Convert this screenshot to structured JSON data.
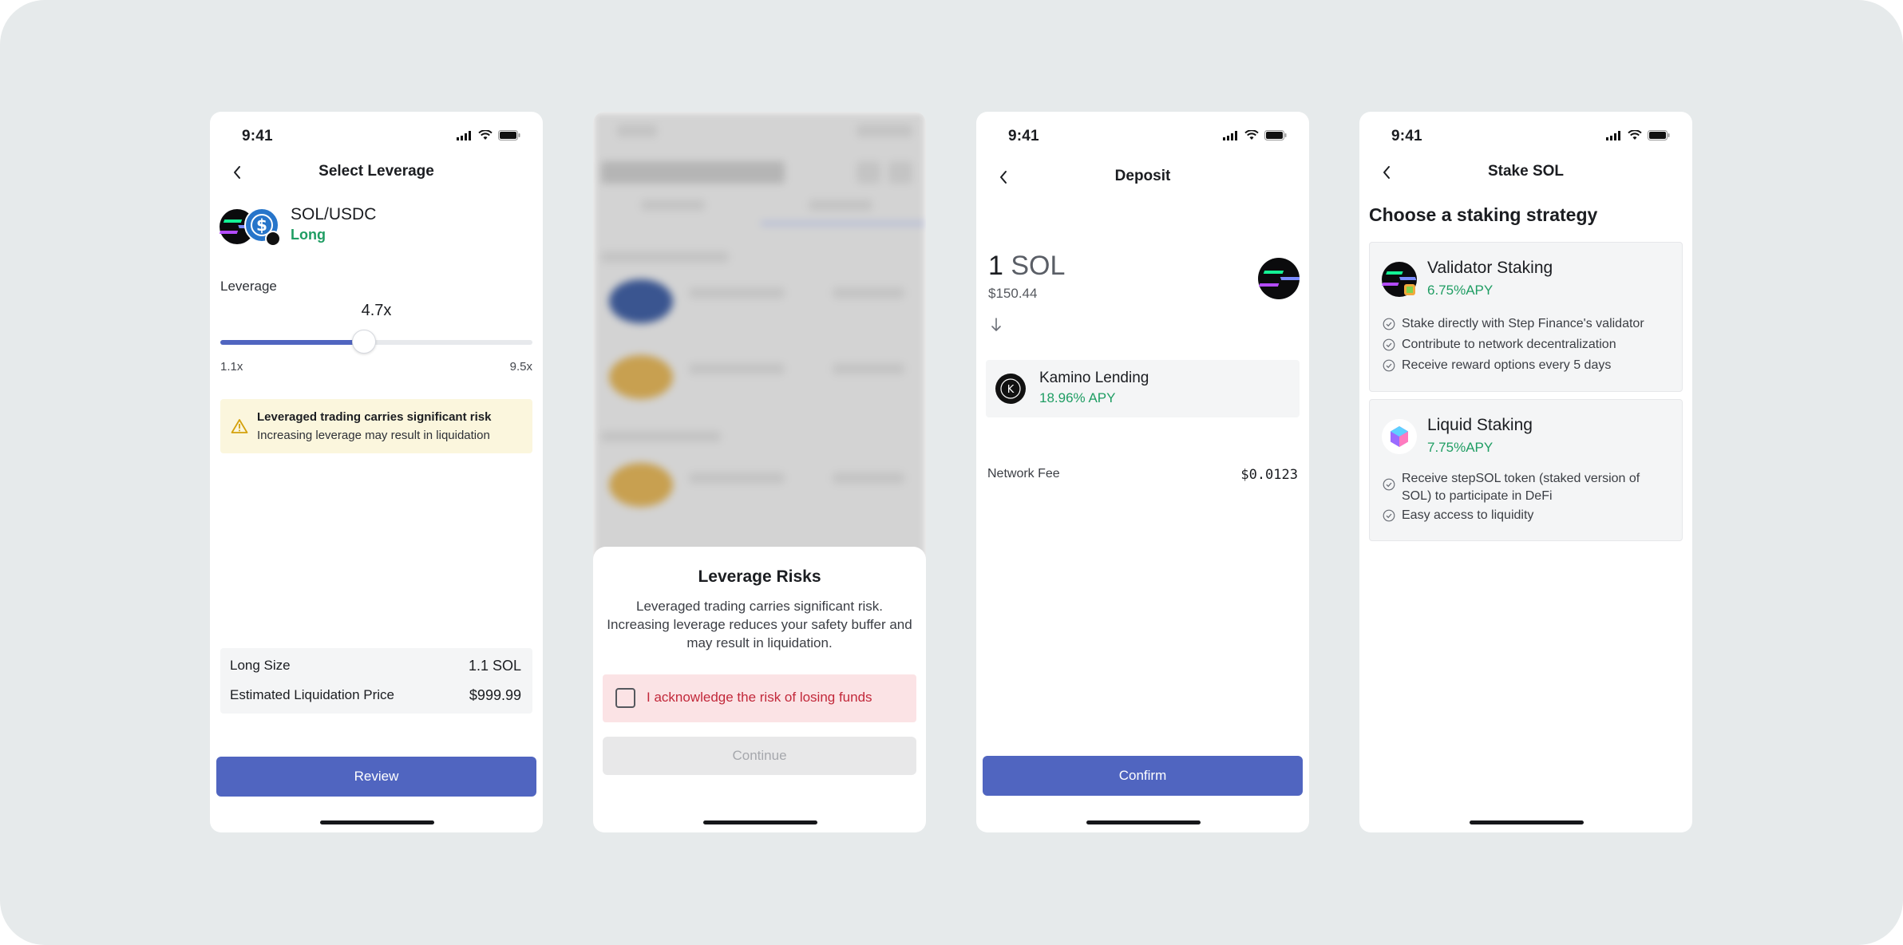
{
  "status": {
    "time": "9:41"
  },
  "leverage_screen": {
    "title": "Select Leverage",
    "pair": "SOL/USDC",
    "side": "Long",
    "leverage_label": "Leverage",
    "leverage_value": "4.7x",
    "slider": {
      "min_label": "1.1x",
      "max_label": "9.5x",
      "position": 0.46
    },
    "warning": {
      "title": "Leveraged trading carries significant risk",
      "subtitle": "Increasing leverage may result in liquidation"
    },
    "summary": [
      {
        "label": "Long Size",
        "value": "1.1 SOL"
      },
      {
        "label": "Estimated Liquidation Price",
        "value": "$999.99"
      }
    ],
    "review_label": "Review"
  },
  "risk_sheet": {
    "title": "Leverage Risks",
    "body": "Leveraged trading carries significant risk. Increasing leverage reduces your safety buffer and may result in liquidation.",
    "ack_label": "I acknowledge the risk of losing funds",
    "continue_label": "Continue"
  },
  "deposit_screen": {
    "title": "Deposit",
    "amount": "1",
    "unit": "SOL",
    "usd_value": "$150.44",
    "destination": {
      "name": "Kamino Lending",
      "apy": "18.96% APY",
      "logo_letter": "K"
    },
    "fee_label": "Network Fee",
    "fee_value": "$0.0123",
    "confirm_label": "Confirm"
  },
  "stake_screen": {
    "title": "Stake SOL",
    "heading": "Choose a staking strategy",
    "strategies": [
      {
        "name": "Validator Staking",
        "apy": "6.75%APY",
        "bullets": [
          "Stake directly with Step Finance's validator",
          "Contribute to network decentralization",
          "Receive reward options every 5 days"
        ]
      },
      {
        "name": "Liquid Staking",
        "apy": "7.75%APY",
        "bullets": [
          "Receive stepSOL token (staked version of SOL) to participate in DeFi",
          "Easy access to liquidity"
        ]
      }
    ]
  },
  "colors": {
    "primary": "#5065c0",
    "success": "#1f9d63",
    "warning_bg": "#fbf6dd",
    "danger": "#c2283a",
    "danger_bg": "#fbe3e5",
    "page_bg": "#e6eaeb"
  }
}
